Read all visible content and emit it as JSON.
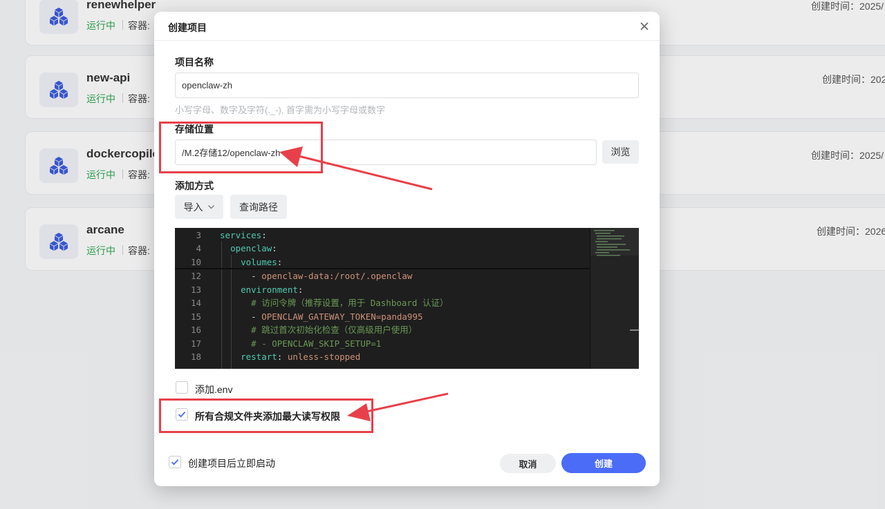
{
  "background_projects": [
    {
      "name": "renewhelper",
      "status": "运行中",
      "container_label": "容器:",
      "created": "创建时间：2025/"
    },
    {
      "name": "new-api",
      "status": "运行中",
      "container_label": "容器:",
      "created": "创建时间：202"
    },
    {
      "name": "dockercopilot",
      "status": "运行中",
      "container_label": "容器:",
      "created": "创建时间：2025/"
    },
    {
      "name": "arcane",
      "status": "运行中",
      "container_label": "容器:",
      "created": "创建时间：2026"
    }
  ],
  "modal": {
    "title": "创建项目",
    "project_name_label": "项目名称",
    "project_name_value": "openclaw-zh",
    "project_name_hint": "小写字母、数字及字符(._-), 首字需为小写字母或数字",
    "storage_label": "存储位置",
    "storage_value": "/M.2存储12/openclaw-zh",
    "browse_label": "浏览",
    "add_method_label": "添加方式",
    "import_label": "导入",
    "query_path_label": "查询路径",
    "add_env_label": "添加.env",
    "max_perm_label": "所有合规文件夹添加最大读写权限",
    "autostart_label": "创建项目后立即启动",
    "cancel_label": "取消",
    "create_label": "创建"
  },
  "code_lines": [
    {
      "n": "3",
      "text": "services:"
    },
    {
      "n": "4",
      "text": "  openclaw:"
    },
    {
      "n": "10",
      "text": "    volumes:"
    },
    {
      "n": "12",
      "text": "      - openclaw-data:/root/.openclaw"
    },
    {
      "n": "13",
      "text": "    environment:"
    },
    {
      "n": "14",
      "text": "      # 访问令牌（推荐设置，用于 Dashboard 认证）"
    },
    {
      "n": "15",
      "text": "      - OPENCLAW_GATEWAY_TOKEN=panda995"
    },
    {
      "n": "16",
      "text": "      # 跳过首次初始化检查（仅高级用户使用）"
    },
    {
      "n": "17",
      "text": "      # - OPENCLAW_SKIP_SETUP=1"
    },
    {
      "n": "18",
      "text": "    restart: unless-stopped"
    }
  ],
  "checkboxes": {
    "add_env": false,
    "max_perm": true,
    "autostart": true
  },
  "colors": {
    "accent": "#4a6cf7",
    "running": "#2fa44f",
    "annotation": "#e8404a"
  },
  "icons": [
    "cube-stack-icon",
    "close-icon",
    "chevron-down-icon",
    "check-icon"
  ]
}
